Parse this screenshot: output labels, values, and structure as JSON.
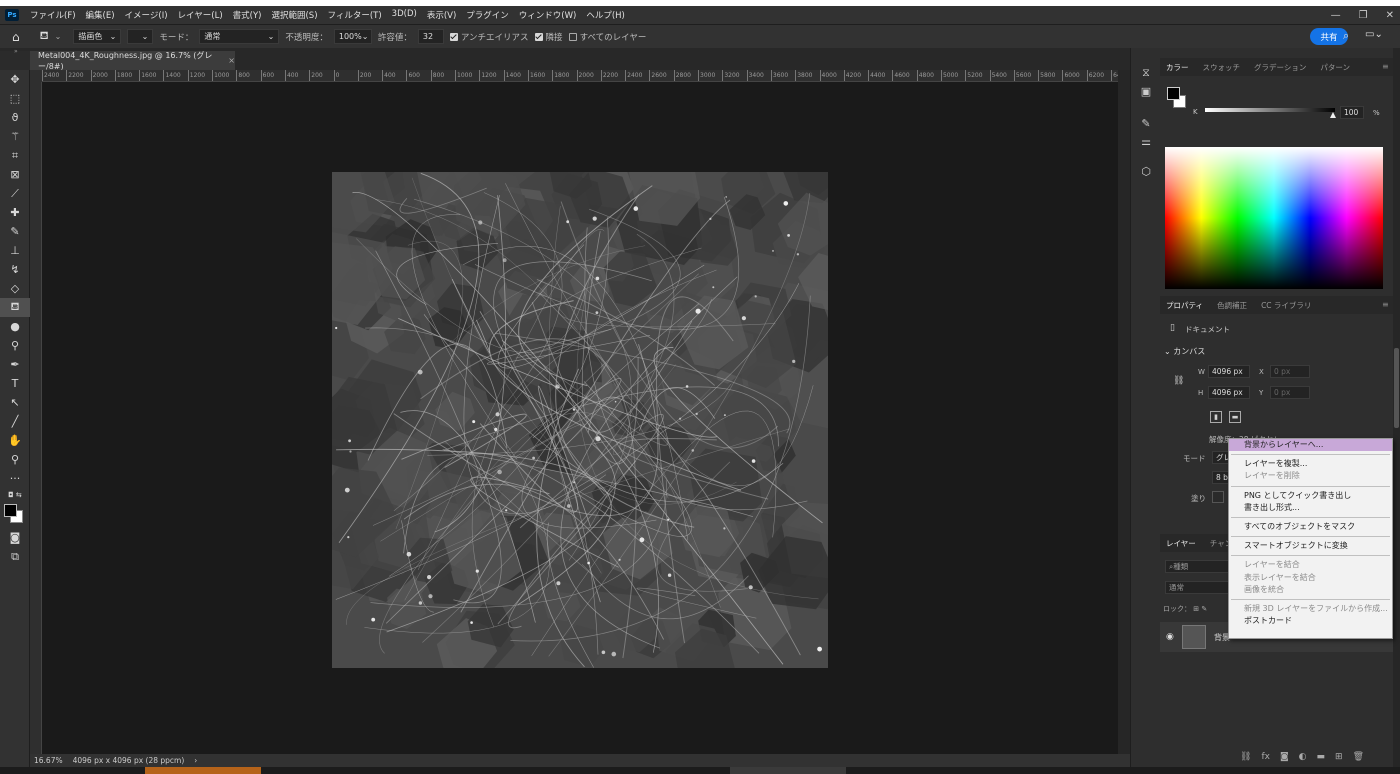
{
  "menu": [
    "ファイル(F)",
    "編集(E)",
    "イメージ(I)",
    "レイヤー(L)",
    "書式(Y)",
    "選択範囲(S)",
    "フィルター(T)",
    "3D(D)",
    "表示(V)",
    "プラグイン",
    "ウィンドウ(W)",
    "ヘルプ(H)"
  ],
  "app_logo": "Ps",
  "options": {
    "fill_source": "描画色",
    "mode_label": "モード：",
    "mode_value": "通常",
    "opacity_label": "不透明度：",
    "opacity_value": "100%",
    "tolerance_label": "許容値：",
    "tolerance_value": "32",
    "antialias": "アンチエイリアス",
    "contiguous": "隣接",
    "all_layers": "すべてのレイヤー",
    "share": "共有"
  },
  "doc_tab": "Metal004_4K_Roughness.jpg @ 16.7% (グレー/8#)",
  "ruler_h": [
    "2400",
    "2200",
    "2000",
    "1800",
    "1600",
    "1400",
    "1200",
    "1000",
    "800",
    "600",
    "400",
    "200",
    "0",
    "200",
    "400",
    "600",
    "800",
    "1000",
    "1200",
    "1400",
    "1600",
    "1800",
    "2000",
    "2200",
    "2400",
    "2600",
    "2800",
    "3000",
    "3200",
    "3400",
    "3600",
    "3800",
    "4000",
    "4200",
    "4400",
    "4600",
    "4800",
    "5000",
    "5200",
    "5400",
    "5600",
    "5800",
    "6000",
    "6200",
    "640"
  ],
  "status": {
    "zoom": "16.67%",
    "size": "4096 px x 4096 px (28 ppcm)",
    "arrow": "›"
  },
  "color_panel": {
    "tabs": [
      "カラー",
      "スウォッチ",
      "グラデーション",
      "パターン"
    ],
    "channel": "K",
    "value": "100",
    "unit": "%"
  },
  "properties": {
    "tabs": [
      "プロパティ",
      "色調補正",
      "CC ライブラリ"
    ],
    "doc_label": "ドキュメント",
    "canvas_label": "カンバス",
    "w_label": "W",
    "w_value": "4096 px",
    "x_label": "X",
    "x_value": "0 px",
    "h_label": "H",
    "h_value": "4096 px",
    "y_label": "Y",
    "y_value": "0 px",
    "resolution": "解像度：28 ピクセル",
    "mode_label": "モード",
    "mode_value": "グレ",
    "depth_value": "8 b",
    "fill_label": "塗り"
  },
  "layers": {
    "tabs": [
      "レイヤー",
      "チャンネル"
    ],
    "search": "種類",
    "blend": "通常",
    "lock_label": "ロック：",
    "layer_name": "背景"
  },
  "context_menu": [
    {
      "label": "背景からレイヤーへ...",
      "state": "highlight"
    },
    {
      "sep": true
    },
    {
      "label": "レイヤーを複製...",
      "state": "normal"
    },
    {
      "label": "レイヤーを削除",
      "state": "disabled"
    },
    {
      "sep": true
    },
    {
      "label": "PNG としてクイック書き出し",
      "state": "normal"
    },
    {
      "label": "書き出し形式...",
      "state": "normal"
    },
    {
      "sep": true
    },
    {
      "label": "すべてのオブジェクトをマスク",
      "state": "normal"
    },
    {
      "sep": true
    },
    {
      "label": "スマートオブジェクトに変換",
      "state": "normal"
    },
    {
      "sep": true
    },
    {
      "label": "レイヤーを結合",
      "state": "disabled"
    },
    {
      "label": "表示レイヤーを結合",
      "state": "disabled"
    },
    {
      "label": "画像を統合",
      "state": "disabled"
    },
    {
      "sep": true
    },
    {
      "label": "新規 3D レイヤーをファイルから作成...",
      "state": "disabled"
    },
    {
      "label": "ポストカード",
      "state": "normal"
    }
  ]
}
